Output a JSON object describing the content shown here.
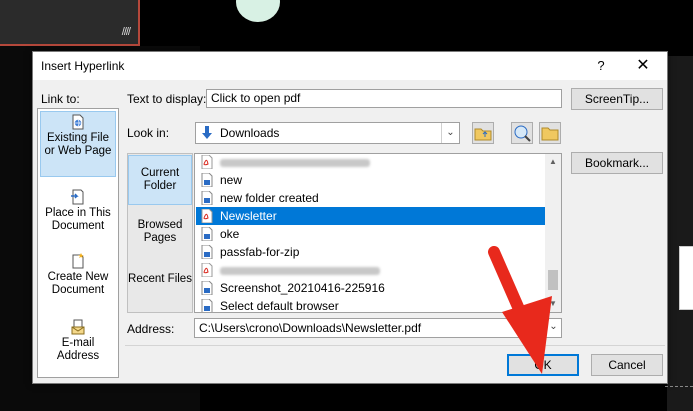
{
  "background": {
    "slide_marks": "////"
  },
  "dialog": {
    "title": "Insert Hyperlink",
    "help_label": "?",
    "close_label": "✕",
    "link_to_label": "Link to:",
    "link_to_items": [
      {
        "label": "Existing File or Web Page"
      },
      {
        "label": "Place in This Document"
      },
      {
        "label": "Create New Document"
      },
      {
        "label": "E-mail Address"
      }
    ],
    "text_to_display_label": "Text to display:",
    "text_to_display_value": "Click to open pdf",
    "screentip_label": "ScreenTip...",
    "look_in_label": "Look in:",
    "look_in_value": "Downloads",
    "bookmark_label": "Bookmark...",
    "scope_items": [
      {
        "label": "Current Folder"
      },
      {
        "label": "Browsed Pages"
      },
      {
        "label": "Recent Files"
      }
    ],
    "files": [
      {
        "name": "",
        "icon": "pdf-icon",
        "blurred": true
      },
      {
        "name": "new",
        "icon": "file-icon"
      },
      {
        "name": "new folder created",
        "icon": "file-icon"
      },
      {
        "name": "Newsletter",
        "icon": "pdf-icon",
        "selected": true
      },
      {
        "name": "oke",
        "icon": "file-icon"
      },
      {
        "name": "passfab-for-zip",
        "icon": "file-icon"
      },
      {
        "name": "",
        "icon": "pdf-icon",
        "blurred": true
      },
      {
        "name": "Screenshot_20210416-225916",
        "icon": "file-icon"
      },
      {
        "name": "Select default browser",
        "icon": "file-icon"
      }
    ],
    "address_label": "Address:",
    "address_value": "C:\\Users\\crono\\Downloads\\Newsletter.pdf",
    "ok_label": "OK",
    "cancel_label": "Cancel"
  },
  "colors": {
    "accent": "#0078d7",
    "arrow": "#e8291c"
  }
}
